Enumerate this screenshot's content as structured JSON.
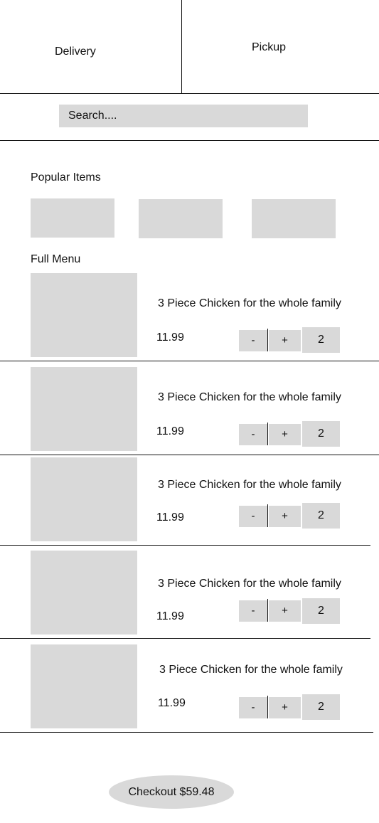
{
  "tabs": {
    "delivery_label": "Delivery",
    "pickup_label": "Pickup"
  },
  "search": {
    "placeholder": "Search...."
  },
  "popular": {
    "title": "Popular Items",
    "tile_count": 3
  },
  "menu": {
    "title": "Full Menu",
    "items": [
      {
        "name": "3 Piece Chicken for the whole family",
        "price": "11.99",
        "minus": "-",
        "plus": "+",
        "qty": "2"
      },
      {
        "name": "3 Piece Chicken for the whole family",
        "price": "11.99",
        "minus": "-",
        "plus": "+",
        "qty": "2"
      },
      {
        "name": "3 Piece Chicken for the whole family",
        "price": "11.99",
        "minus": "-",
        "plus": "+",
        "qty": "2"
      },
      {
        "name": "3 Piece Chicken for the whole family",
        "price": "11.99",
        "minus": "-",
        "plus": "+",
        "qty": "2"
      },
      {
        "name": "3 Piece Chicken for the whole family",
        "price": "11.99",
        "minus": "-",
        "plus": "+",
        "qty": "2"
      }
    ]
  },
  "checkout": {
    "label": "Checkout $59.48"
  },
  "colors": {
    "placeholder_gray": "#d9d9d9",
    "line": "#111111",
    "background": "#ffffff"
  }
}
